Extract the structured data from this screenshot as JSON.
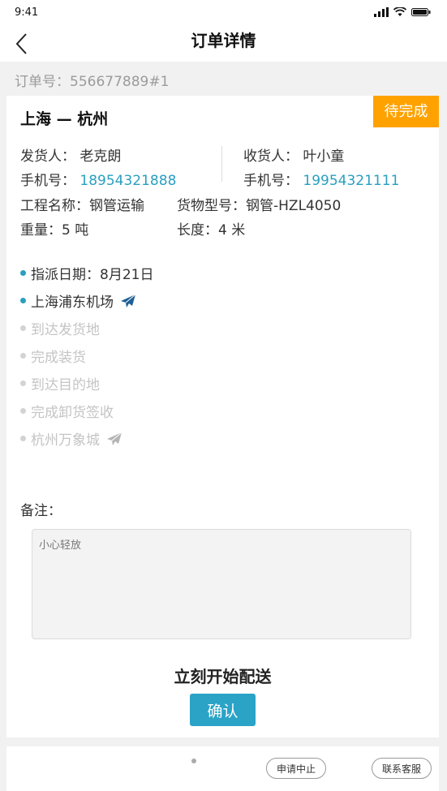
{
  "status_bar": {
    "time": "9:41"
  },
  "nav": {
    "title": "订单详情"
  },
  "order": {
    "number_label": "订单号：",
    "number": "556677889#1"
  },
  "route": {
    "from": "上海",
    "separator": "—",
    "to": "杭州"
  },
  "status": {
    "label": "待完成",
    "color": "#ffa200"
  },
  "sender": {
    "label": "发货人：",
    "name": "老克朗",
    "phone_label": "手机号：",
    "phone": "18954321888"
  },
  "receiver": {
    "label": "收货人：",
    "name": "叶小童",
    "phone_label": "手机号：",
    "phone": "19954321111"
  },
  "project": {
    "label": "工程名称：",
    "value": "钢管运输"
  },
  "cargo_model": {
    "label": "货物型号：",
    "value": "钢管-HZL4050"
  },
  "weight": {
    "label": "重量：",
    "value": "5 吨"
  },
  "length": {
    "label": "长度：",
    "value": "4 米"
  },
  "timeline": [
    {
      "label": "指派日期：8月21日",
      "active": true,
      "icon": ""
    },
    {
      "label": "上海浦东机场",
      "active": true,
      "icon": "plane-icon"
    },
    {
      "label": "到达发货地",
      "active": false,
      "icon": ""
    },
    {
      "label": "完成装货",
      "active": false,
      "icon": ""
    },
    {
      "label": "到达目的地",
      "active": false,
      "icon": ""
    },
    {
      "label": "完成卸货签收",
      "active": false,
      "icon": ""
    },
    {
      "label": "杭州万象城",
      "active": false,
      "icon": "plane-icon"
    }
  ],
  "remark": {
    "label": "备注：",
    "value": "小心轻放"
  },
  "action": {
    "title": "立刻开始配送",
    "confirm_label": "确认",
    "accent": "#2aa3c7"
  },
  "bottom": {
    "abort_label": "申请中止",
    "service_label": "联系客服"
  }
}
